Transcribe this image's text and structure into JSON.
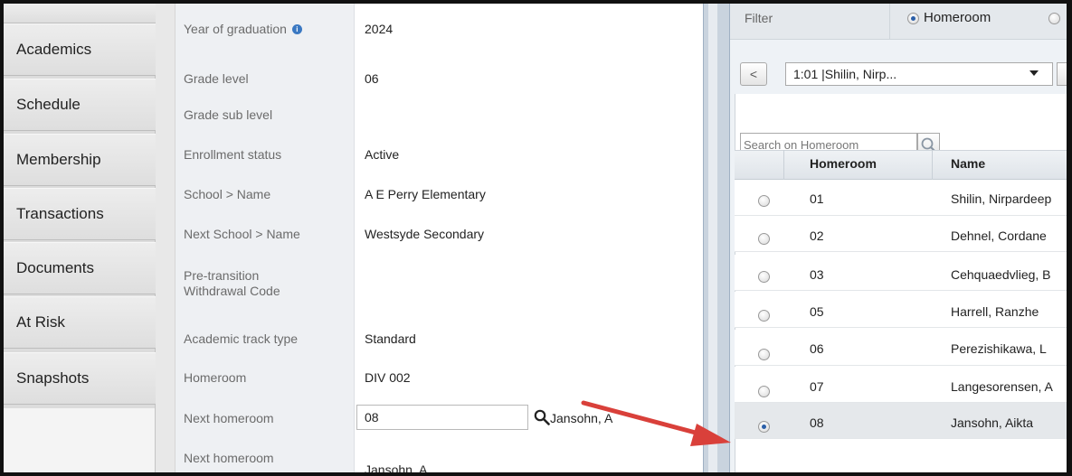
{
  "sidebar": {
    "items": [
      {
        "label": "Academics"
      },
      {
        "label": "Schedule"
      },
      {
        "label": "Membership"
      },
      {
        "label": "Transactions"
      },
      {
        "label": "Documents"
      },
      {
        "label": "At Risk"
      },
      {
        "label": "Snapshots"
      }
    ]
  },
  "details": {
    "rows": [
      {
        "label": "Year of graduation",
        "value": "2024"
      },
      {
        "label": "Grade level",
        "value": "06"
      },
      {
        "label": "Grade sub level",
        "value": ""
      },
      {
        "label": "Enrollment status",
        "value": "Active"
      },
      {
        "label": "School > Name",
        "value": "A E Perry Elementary"
      },
      {
        "label": "Next School > Name",
        "value": "Westsyde Secondary"
      },
      {
        "label_line1": "Pre-transition",
        "label_line2": "Withdrawal Code",
        "value": ""
      },
      {
        "label": "Academic track type",
        "value": "Standard"
      },
      {
        "label": "Homeroom",
        "value": "DIV 002"
      },
      {
        "label": "Next homeroom",
        "value": "08",
        "resolved": "Jansohn, A"
      },
      {
        "label": "Next homeroom",
        "value": "Jansohn, A"
      }
    ]
  },
  "picker": {
    "filter_label": "Filter",
    "filter_option": "Homeroom",
    "prev_label": "<",
    "selected_option": "1:01 |Shilin, Nirp...",
    "search_placeholder": "Search on Homeroom",
    "columns": {
      "homeroom": "Homeroom",
      "name": "Name"
    },
    "rows": [
      {
        "homeroom": "01",
        "name": "Shilin, Nirpardeep"
      },
      {
        "homeroom": "02",
        "name": "Dehnel, Cordane"
      },
      {
        "homeroom": "03",
        "name": "Cehquaedvlieg, B"
      },
      {
        "homeroom": "05",
        "name": "Harrell, Ranzhe"
      },
      {
        "homeroom": "06",
        "name": "Perezishikawa, L"
      },
      {
        "homeroom": "07",
        "name": "Langesorensen, A"
      },
      {
        "homeroom": "08",
        "name": "Jansohn, Aikta"
      }
    ]
  },
  "colors": {
    "arrow": "#d9403a",
    "radio_selected": "#2b5fa8"
  }
}
